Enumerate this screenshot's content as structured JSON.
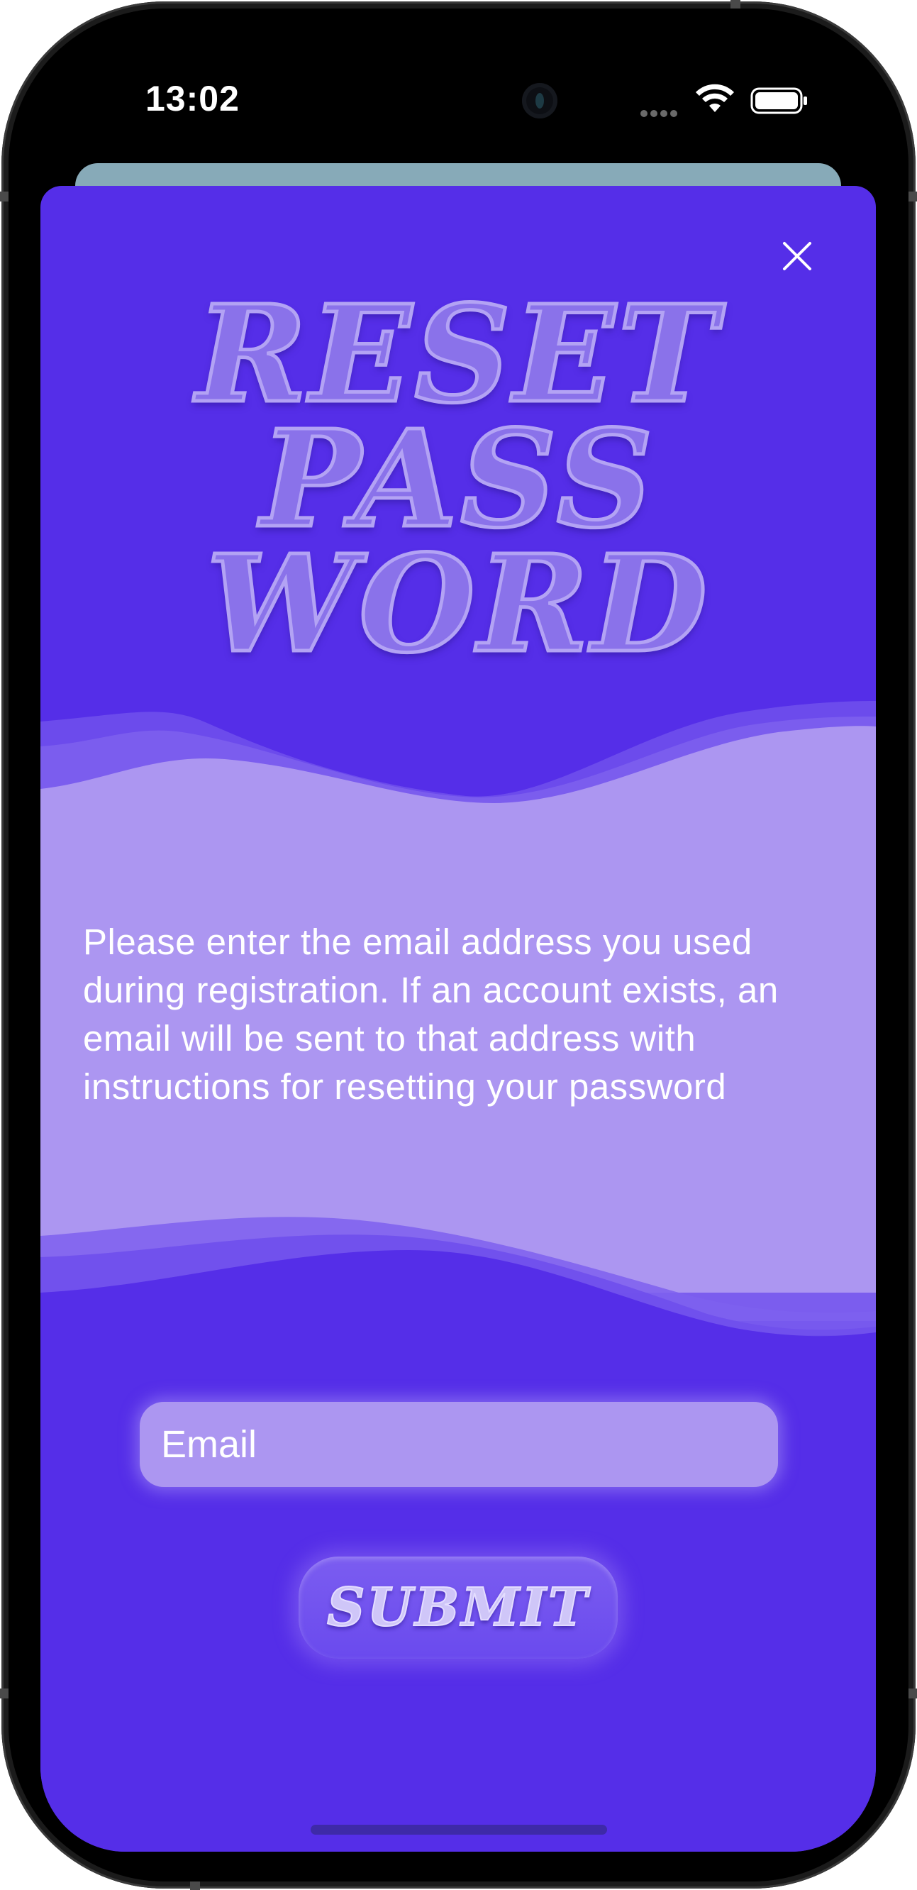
{
  "status_bar": {
    "time": "13:02",
    "icons": [
      "signal-dots-icon",
      "wifi-icon",
      "battery-icon"
    ]
  },
  "modal": {
    "close_icon": "close-icon",
    "title_lines": [
      "RESET",
      "PASS",
      "WORD"
    ],
    "instructions": "Please enter the email address you used during registration. If an account exists, an email will be sent to that address with instructions for resetting your password",
    "email_field": {
      "placeholder": "Email",
      "value": ""
    },
    "submit_label": "SUBMIT"
  },
  "colors": {
    "modal_background": "#552ee8",
    "wave_light": "#ac96f1",
    "wave_mid": "#8a6ef0",
    "sheet_behind": "#87aab8",
    "text": "#ffffff"
  }
}
